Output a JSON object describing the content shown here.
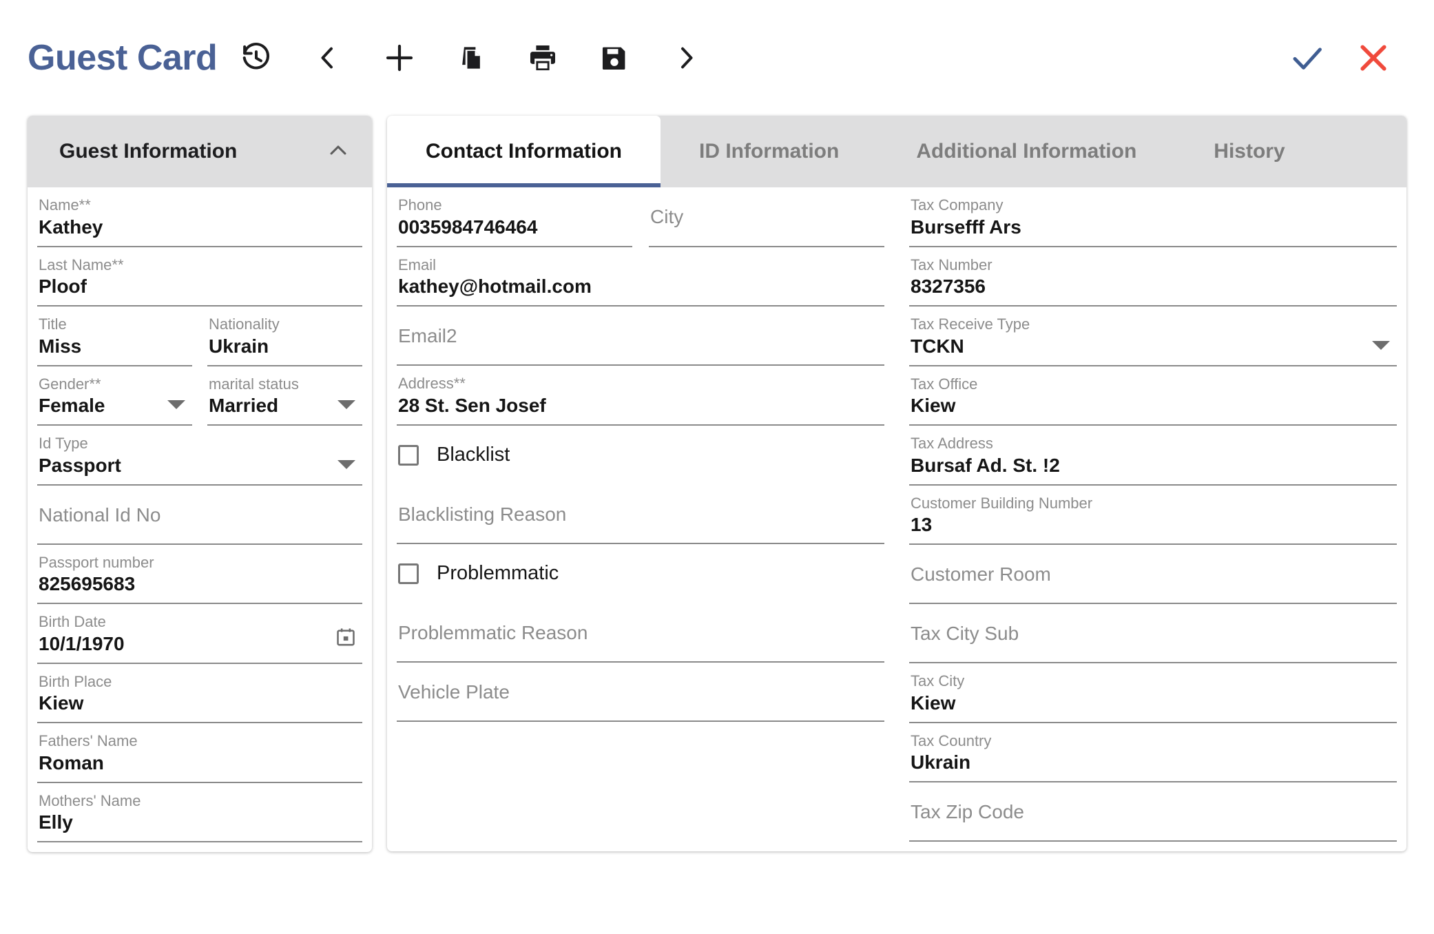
{
  "header": {
    "title": "Guest Card",
    "toolbar": [
      {
        "name": "history-icon",
        "label": "History"
      },
      {
        "name": "chevron-left-icon",
        "label": "Previous"
      },
      {
        "name": "plus-icon",
        "label": "New"
      },
      {
        "name": "copy-icon",
        "label": "Copy"
      },
      {
        "name": "print-icon",
        "label": "Print"
      },
      {
        "name": "save-icon",
        "label": "Save"
      },
      {
        "name": "chevron-right-icon",
        "label": "Next"
      }
    ],
    "actions": [
      {
        "name": "confirm-icon",
        "label": "Confirm",
        "color": "#3f5d92"
      },
      {
        "name": "cancel-icon",
        "label": "Cancel",
        "color": "#f04a3c"
      }
    ]
  },
  "guest_information": {
    "panel_title": "Guest Information",
    "collapse_icon": "chevron-up-icon",
    "fields": {
      "name": {
        "label": "Name**",
        "value": "Kathey"
      },
      "last_name": {
        "label": "Last Name**",
        "value": "Ploof"
      },
      "title": {
        "label": "Title",
        "value": "Miss"
      },
      "nationality": {
        "label": "Nationality",
        "value": "Ukrain"
      },
      "gender": {
        "label": "Gender**",
        "value": "Female"
      },
      "marital_status": {
        "label": "marital status",
        "value": "Married"
      },
      "id_type": {
        "label": "Id Type",
        "value": "Passport"
      },
      "national_id_no": {
        "label": "National Id No",
        "value": ""
      },
      "passport_number": {
        "label": "Passport number",
        "value": "825695683"
      },
      "birth_date": {
        "label": "Birth Date",
        "value": "10/1/1970"
      },
      "birth_place": {
        "label": "Birth Place",
        "value": "Kiew"
      },
      "fathers_name": {
        "label": "Fathers' Name",
        "value": "Roman"
      },
      "mothers_name": {
        "label": "Mothers' Name",
        "value": "Elly"
      }
    }
  },
  "tabs": [
    {
      "label": "Contact Information",
      "active": true
    },
    {
      "label": "ID Information",
      "active": false
    },
    {
      "label": "Additional Information",
      "active": false
    },
    {
      "label": "History",
      "active": false
    }
  ],
  "contact": {
    "phone": {
      "label": "Phone",
      "value": "0035984746464"
    },
    "city": {
      "label": "City",
      "value": ""
    },
    "email": {
      "label": "Email",
      "value": "kathey@hotmail.com"
    },
    "email2": {
      "label": "Email2",
      "value": ""
    },
    "address": {
      "label": "Address**",
      "value": "28 St. Sen Josef"
    },
    "blacklist": {
      "label": "Blacklist",
      "checked": false
    },
    "blacklisting_reason": {
      "label": "Blacklisting Reason",
      "value": ""
    },
    "problemmatic": {
      "label": "Problemmatic",
      "checked": false
    },
    "problemmatic_reason": {
      "label": "Problemmatic Reason",
      "value": ""
    },
    "vehicle_plate": {
      "label": "Vehicle Plate",
      "value": ""
    }
  },
  "tax": {
    "tax_company": {
      "label": "Tax Company",
      "value": "Bursefff Ars"
    },
    "tax_number": {
      "label": "Tax Number",
      "value": "8327356"
    },
    "tax_receive_type": {
      "label": "Tax Receive Type",
      "value": "TCKN"
    },
    "tax_office": {
      "label": "Tax Office",
      "value": "Kiew"
    },
    "tax_address": {
      "label": "Tax Address",
      "value": "Bursaf Ad. St. !2"
    },
    "customer_building_number": {
      "label": "Customer Building Number",
      "value": "13"
    },
    "customer_room": {
      "label": "Customer Room",
      "value": ""
    },
    "tax_city_sub": {
      "label": "Tax City Sub",
      "value": ""
    },
    "tax_city": {
      "label": "Tax City",
      "value": "Kiew"
    },
    "tax_country": {
      "label": "Tax Country",
      "value": "Ukrain"
    },
    "tax_zip_code": {
      "label": "Tax Zip Code",
      "value": ""
    }
  },
  "colors": {
    "brand_blue": "#4a6195",
    "danger_red": "#f04a3c",
    "panel_gray": "#dededf",
    "label_gray": "#8c8c8c",
    "underline_gray": "#8a8a8a"
  }
}
